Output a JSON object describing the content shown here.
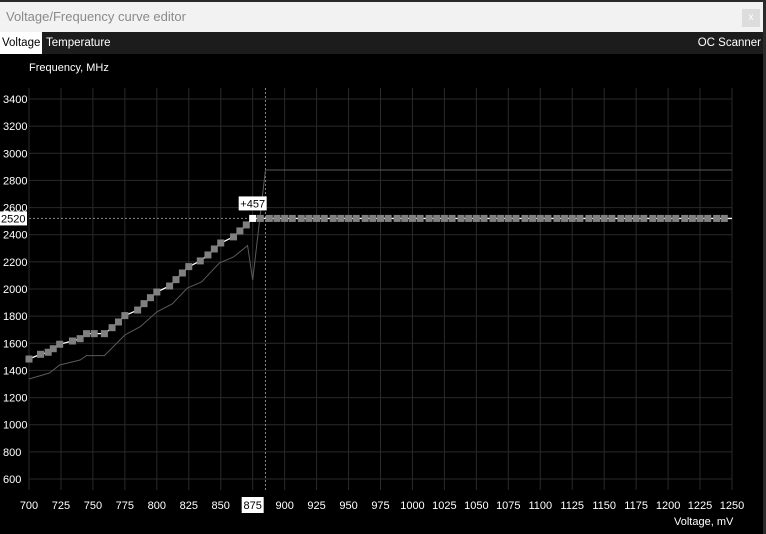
{
  "window": {
    "title": "Voltage/Frequency curve editor",
    "close_label": "x"
  },
  "tabs": [
    {
      "label": "Voltage",
      "active": true
    },
    {
      "label": "Temperature",
      "active": false
    }
  ],
  "oc_scanner_label": "OC Scanner",
  "chart_data": {
    "type": "line",
    "ylabel": "Frequency, MHz",
    "xlabel": "Voltage, mV",
    "xlim": [
      700,
      1250
    ],
    "ylim": [
      600,
      3400
    ],
    "x_ticks": [
      700,
      725,
      750,
      775,
      800,
      825,
      850,
      875,
      900,
      925,
      950,
      975,
      1000,
      1025,
      1050,
      1075,
      1100,
      1125,
      1150,
      1175,
      1200,
      1225,
      1250
    ],
    "y_ticks": [
      600,
      800,
      1000,
      1200,
      1400,
      1600,
      1800,
      2000,
      2200,
      2400,
      2600,
      2800,
      3000,
      3200,
      3400
    ],
    "grid": true,
    "highlighted_x_tick": 875,
    "selected_point": {
      "voltage": 875,
      "frequency": 2520,
      "frequency_label": "2520",
      "offset_label": "+457"
    },
    "crosshair": {
      "voltage": 885,
      "frequency": 2520
    },
    "colors": {
      "curve": "#ffffff",
      "points": "#808080",
      "default_curve": "#5a5a5a",
      "grid": "#2a2a2a"
    },
    "curve_points": [
      [
        700,
        1484
      ],
      [
        709,
        1519
      ],
      [
        715,
        1534
      ],
      [
        719,
        1560
      ],
      [
        724,
        1593
      ],
      [
        734,
        1617
      ],
      [
        740,
        1634
      ],
      [
        745,
        1671
      ],
      [
        751,
        1671
      ],
      [
        759,
        1671
      ],
      [
        765,
        1715
      ],
      [
        770,
        1757
      ],
      [
        775,
        1804
      ],
      [
        785,
        1845
      ],
      [
        790,
        1892
      ],
      [
        795,
        1936
      ],
      [
        800,
        1978
      ],
      [
        810,
        2022
      ],
      [
        815,
        2069
      ],
      [
        820,
        2118
      ],
      [
        825,
        2165
      ],
      [
        834,
        2207
      ],
      [
        840,
        2251
      ],
      [
        845,
        2295
      ],
      [
        850,
        2339
      ],
      [
        860,
        2384
      ],
      [
        865,
        2428
      ],
      [
        870,
        2472
      ],
      [
        875,
        2520
      ]
    ],
    "flat_points": {
      "frequency": 2520,
      "voltages": [
        881,
        888,
        894,
        900,
        906,
        913,
        919,
        925,
        931,
        938,
        944,
        950,
        956,
        963,
        969,
        975,
        981,
        988,
        994,
        1000,
        1006,
        1013,
        1019,
        1025,
        1031,
        1038,
        1044,
        1050,
        1056,
        1063,
        1069,
        1075,
        1081,
        1088,
        1094,
        1100,
        1106,
        1113,
        1119,
        1125,
        1131,
        1138,
        1144,
        1150,
        1156,
        1163,
        1169,
        1175,
        1181,
        1188,
        1194,
        1200,
        1206,
        1213,
        1219,
        1225,
        1231,
        1238,
        1244
      ]
    },
    "default_curve": [
      [
        700,
        1337
      ],
      [
        716,
        1381
      ],
      [
        724,
        1440
      ],
      [
        740,
        1477
      ],
      [
        745,
        1509
      ],
      [
        759,
        1509
      ],
      [
        775,
        1661
      ],
      [
        787,
        1722
      ],
      [
        800,
        1831
      ],
      [
        812,
        1890
      ],
      [
        824,
        2008
      ],
      [
        835,
        2052
      ],
      [
        849,
        2192
      ],
      [
        860,
        2236
      ],
      [
        871,
        2320
      ],
      [
        875,
        2066
      ],
      [
        885,
        2877
      ],
      [
        1250,
        2877
      ]
    ]
  }
}
